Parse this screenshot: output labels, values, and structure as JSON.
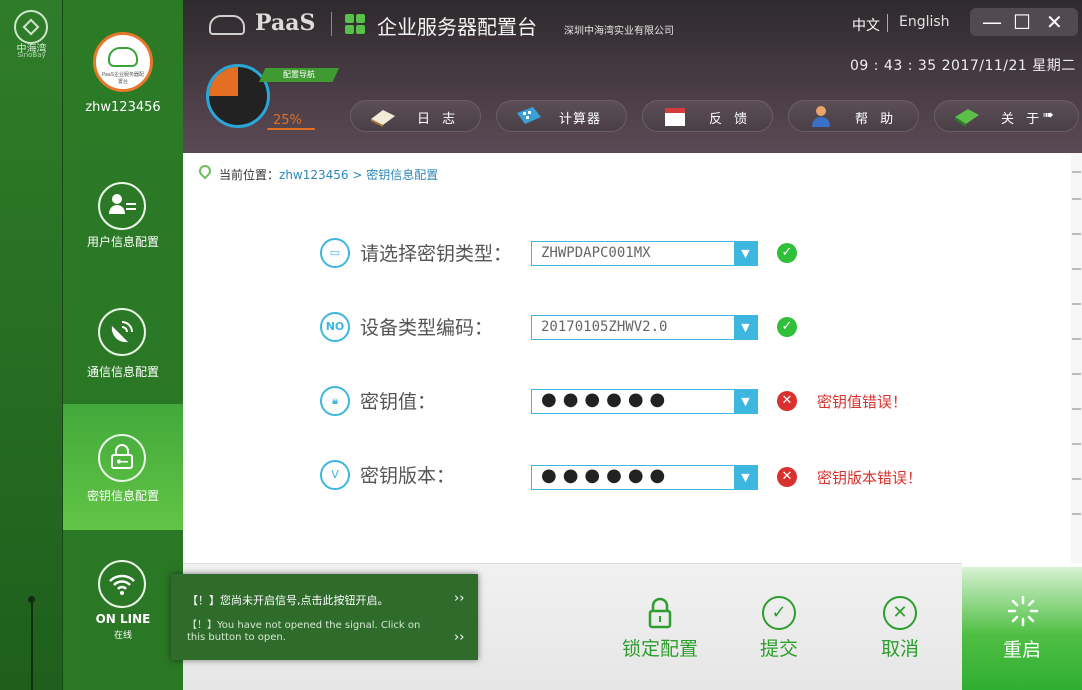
{
  "rail": {
    "logo_name": "中海湾",
    "logo_sub": "SinoBay"
  },
  "user": {
    "avatar_text": "PaaS企业服务器配置台",
    "username": "zhw123456"
  },
  "sidebar": {
    "items": [
      {
        "label": "用户信息配置",
        "icon": "user-card-icon"
      },
      {
        "label": "通信信息配置",
        "icon": "satellite-dish-icon"
      },
      {
        "label": "密钥信息配置",
        "icon": "lock-key-icon",
        "active": true
      }
    ],
    "online_label": "ON LINE",
    "online_sub": "在线"
  },
  "header": {
    "brand": "PaaS",
    "app_title": "企业服务器配置台",
    "company": "深圳中海湾实业有限公司",
    "lang_zh": "中文",
    "lang_en": "English",
    "window_controls": {
      "minimize": "—",
      "maximize": "☐",
      "close": "✕"
    },
    "clock": "09 : 43 : 35   2017/11/21   星期二",
    "progress_tag": "配置导航",
    "progress_percent": "25%",
    "progress_value": 25,
    "nav": [
      {
        "label": "日 志",
        "icon": "book-icon"
      },
      {
        "label": "计算器",
        "icon": "calculator-icon"
      },
      {
        "label": "反 馈",
        "icon": "calendar-icon"
      },
      {
        "label": "帮 助",
        "icon": "person-help-icon"
      },
      {
        "label": "关 于",
        "icon": "info-book-icon",
        "arrow": "➠"
      }
    ]
  },
  "breadcrumb": {
    "prefix": "当前位置：",
    "user": "zhw123456",
    "sep": " > ",
    "page": "密钥信息配置"
  },
  "form": {
    "rows": [
      {
        "label": "请选择密钥类型：",
        "value": "ZHWPDAPC001MX",
        "status": "ok",
        "icon": "monitor-icon",
        "icon_text": "▭"
      },
      {
        "label": "设备类型编码：",
        "value": "20170105ZHWV2.0",
        "status": "ok",
        "icon": "no-icon",
        "icon_text": "NO"
      },
      {
        "label": "密钥值：",
        "value": "●●●●●●",
        "status": "error",
        "message": "密钥值错误！",
        "icon": "padlock-icon",
        "icon_text": "🔒︎"
      },
      {
        "label": "密钥版本：",
        "value": "●●●●●●",
        "status": "error",
        "message": "密钥版本错误！",
        "icon": "version-icon",
        "icon_text": "V"
      }
    ],
    "ok_mark": "✓",
    "err_mark": "✕",
    "dropdown_mark": "▼"
  },
  "actions": {
    "lock": "锁定配置",
    "submit": "提交",
    "cancel": "取消",
    "restart": "重启"
  },
  "notify": {
    "line1": "【！】您尚未开启信号,点击此按钮开启。",
    "line2": "【！】You have not opened the signal. Click on this button to open.",
    "chevron": "››"
  },
  "colors": {
    "brand_green": "#2b7a26",
    "accent_blue": "#3db6e0",
    "ok_green": "#2fbf3a",
    "error_red": "#d9322e",
    "progress_orange": "#e46f22"
  }
}
